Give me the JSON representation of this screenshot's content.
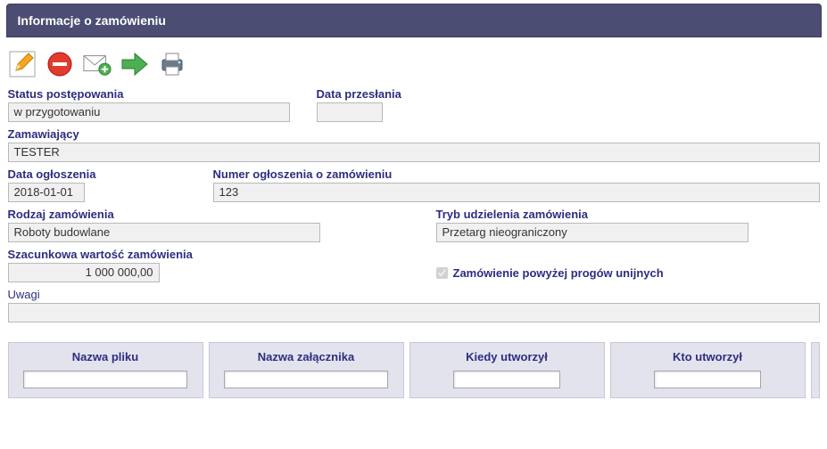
{
  "panel": {
    "title": "Informacje o zamówieniu"
  },
  "toolbar": {
    "edit": "edit",
    "delete": "delete",
    "mail": "mail-add",
    "forward": "forward",
    "print": "print"
  },
  "fields": {
    "status_label": "Status postępowania",
    "status_value": "w przygotowaniu",
    "sent_date_label": "Data przesłania",
    "sent_date_value": "",
    "orderer_label": "Zamawiający",
    "orderer_value": "TESTER",
    "announce_date_label": "Data ogłoszenia",
    "announce_date_value": "2018-01-01",
    "announce_no_label": "Numer ogłoszenia o zamówieniu",
    "announce_no_value": "123",
    "order_type_label": "Rodzaj zamówienia",
    "order_type_value": "Roboty budowlane",
    "award_mode_label": "Tryb udzielenia zamówienia",
    "award_mode_value": "Przetarg nieograniczony",
    "est_value_label": "Szacunkowa wartość zamówienia",
    "est_value_value": "1 000 000,00",
    "above_thresholds_label": "Zamówienie powyżej progów unijnych",
    "above_thresholds_checked": true,
    "notes_label": "Uwagi",
    "notes_value": ""
  },
  "attachments": {
    "cols": [
      {
        "header": "Nazwa pliku"
      },
      {
        "header": "Nazwa załącznika"
      },
      {
        "header": "Kiedy utworzył"
      },
      {
        "header": "Kto utworzył"
      }
    ]
  }
}
